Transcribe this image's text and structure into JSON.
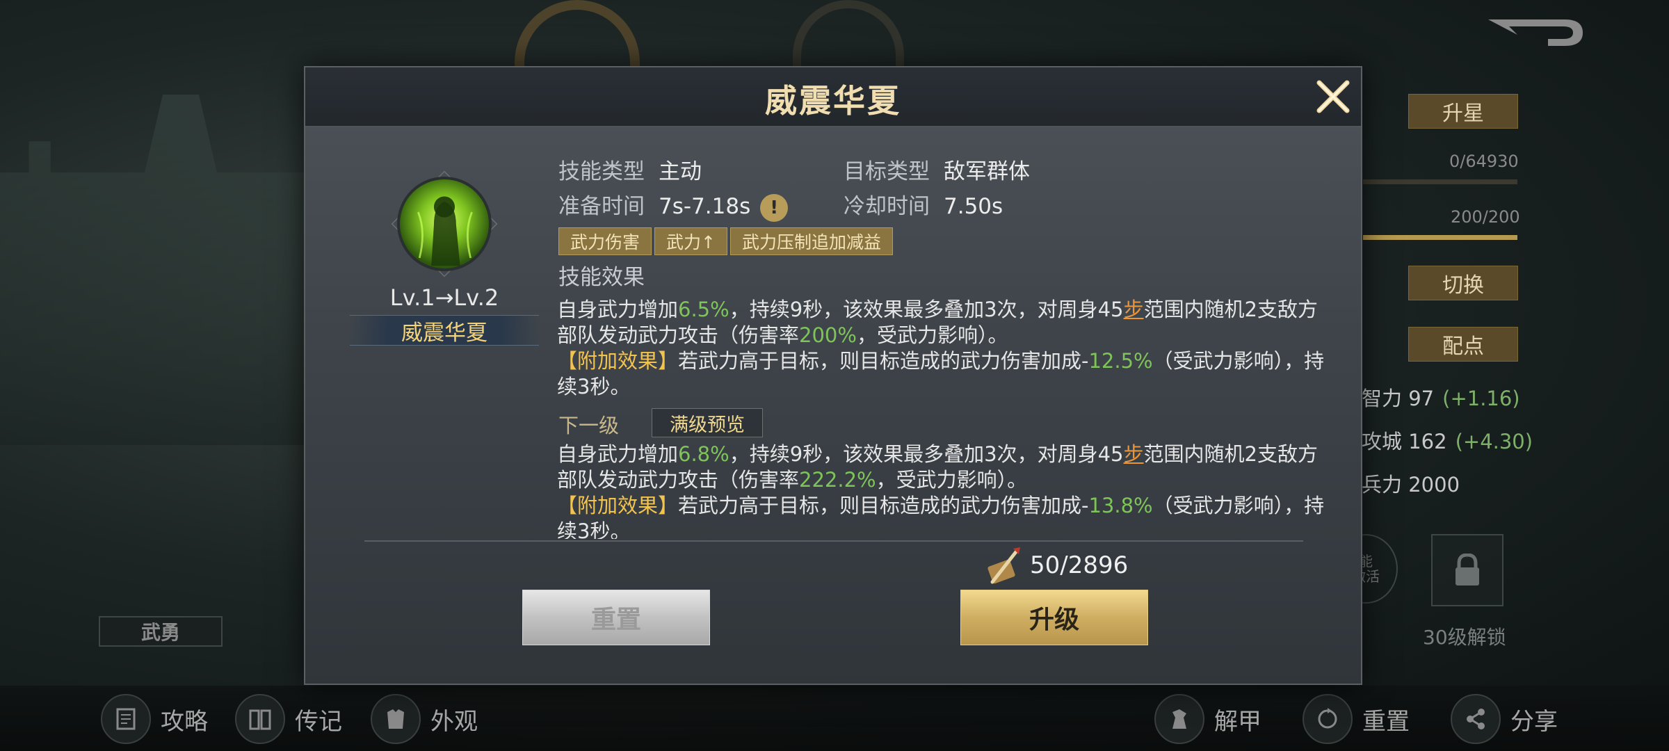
{
  "background": {
    "side_buttons": {
      "star_up": "升星",
      "switch": "切换",
      "allocate": "配点"
    },
    "progress_texts": {
      "exp": "0/64930",
      "stamina": "200/200"
    },
    "stamina_fill": 1.0,
    "stats": [
      {
        "label": "智力 97",
        "bonus": "(+1.16)"
      },
      {
        "label": "攻城 162",
        "bonus": "(+4.30)"
      },
      {
        "label": "兵力 2000",
        "bonus": ""
      }
    ],
    "round_icon_text": [
      "能",
      "激活"
    ],
    "unlock_text": "30级解锁",
    "left_tag": "武勇"
  },
  "bottom_nav": {
    "left": [
      {
        "label": "攻略",
        "icon": "scroll-icon"
      },
      {
        "label": "传记",
        "icon": "book-icon"
      },
      {
        "label": "外观",
        "icon": "armor-icon"
      }
    ],
    "right": [
      {
        "label": "解甲",
        "icon": "horse-icon"
      },
      {
        "label": "重置",
        "icon": "reset-icon"
      },
      {
        "label": "分享",
        "icon": "share-icon"
      }
    ]
  },
  "dialog": {
    "title": "威震华夏",
    "skill": {
      "level_text": "Lv.1→Lv.2",
      "name": "威震华夏",
      "skill_type_label": "技能类型",
      "skill_type": "主动",
      "target_type_label": "目标类型",
      "target_type": "敌军群体",
      "prepare_label": "准备时间",
      "prepare_time": "7s-7.18s",
      "cooldown_label": "冷却时间",
      "cooldown_time": "7.50s",
      "tags": [
        "武力伤害",
        "武力↑",
        "武力压制追加减益"
      ]
    },
    "effect_title": "技能效果",
    "current_effect": {
      "p1": "自身武力增加",
      "v1": "6.5%",
      "p2": "，持续9秒，该效果最多叠加3次，对周身45",
      "step": "步",
      "p3": "范围内随机2支敌方部队发动武力攻击（伤害率",
      "v2": "200%",
      "p4": "，受武力影响）。",
      "extra_label": "【附加效果】",
      "p5": "若武力高于目标，则目标造成的武力伤害加成-",
      "v3": "12.5%",
      "p6": "（受武力影响），持续3秒。"
    },
    "next_label": "下一级",
    "preview_label": "满级预览",
    "next_effect": {
      "p1": "自身武力增加",
      "v1": "6.8%",
      "p2": "，持续9秒，该效果最多叠加3次，对周身45",
      "step": "步",
      "p3": "范围内随机2支敌方部队发动武力攻击（伤害率",
      "v2": "222.2%",
      "p4": "，受武力影响）。",
      "extra_label": "【附加效果】",
      "p5": "若武力高于目标，则目标造成的武力伤害加成-",
      "v3": "13.8%",
      "p6": "（受武力影响），持续3秒。"
    },
    "cost": "50/2896",
    "reset_label": "重置",
    "upgrade_label": "升级"
  },
  "colors": {
    "gold_title": "#f0ddb0",
    "green_value": "#7fc45a",
    "orange_step": "#e7963a",
    "yellow_extra": "#f2c34e",
    "upgrade_button": "#cfae62"
  }
}
